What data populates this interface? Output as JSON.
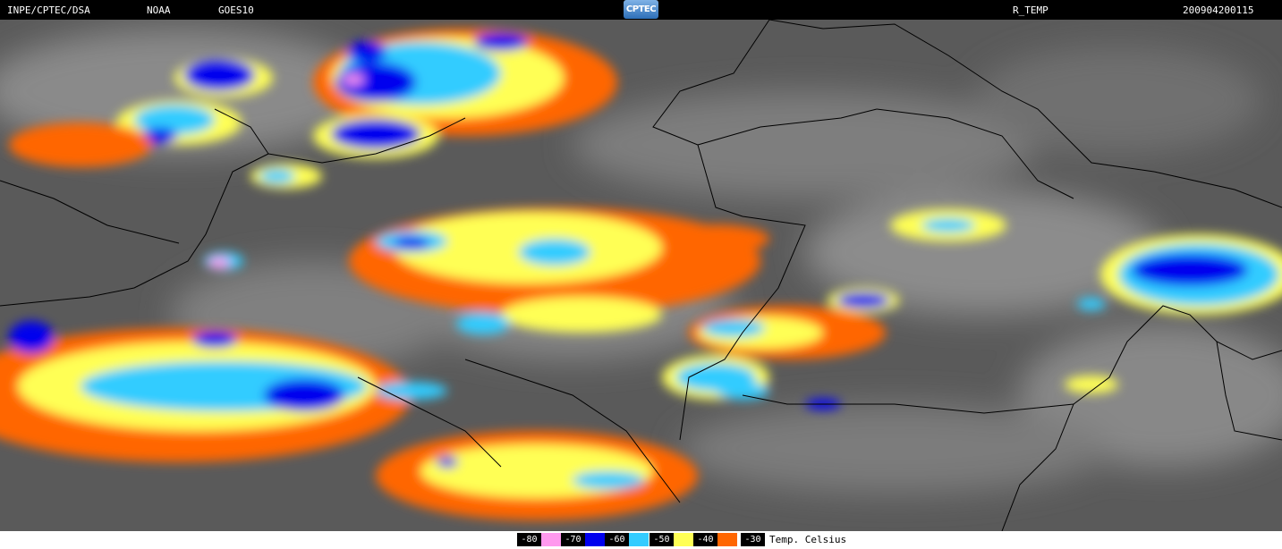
{
  "header": {
    "agency": "INPE/CPTEC/DSA",
    "source": "NOAA",
    "satellite": "GOES10",
    "logo_text": "CPTEC",
    "product": "R_TEMP",
    "timestamp": "200904200115"
  },
  "legend": {
    "items": [
      {
        "label": "-80",
        "color": "#ff99ee"
      },
      {
        "label": "-70",
        "color": "#0000ee"
      },
      {
        "label": "-60",
        "color": "#33ccff"
      },
      {
        "label": "-50",
        "color": "#ffff55"
      },
      {
        "label": "-40",
        "color": "#ff6600"
      },
      {
        "label": "-30",
        "color": ""
      }
    ],
    "unit": "Temp. Celsius"
  },
  "colors": {
    "background": "#5a5a5a",
    "borders": "#000000",
    "very_cold": "#ff99ee",
    "cold": "#0000ee",
    "cool": "#33ccff",
    "mild": "#ffff55",
    "warm": "#ff6600"
  }
}
